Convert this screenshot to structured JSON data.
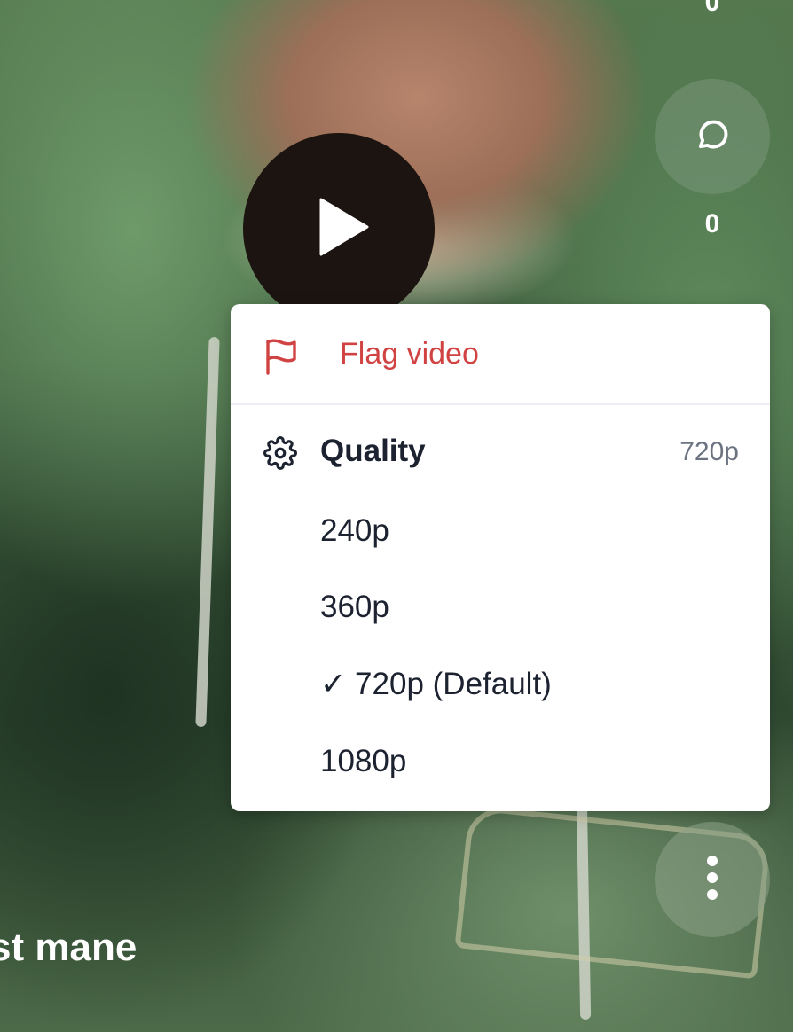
{
  "video": {
    "caption": "st mane"
  },
  "rail": {
    "top_count": "0",
    "comment_count": "0",
    "comment_icon": "comment-bubble-icon",
    "more_icon": "more-vertical-icon"
  },
  "player": {
    "play_icon": "play-icon"
  },
  "menu": {
    "flag": {
      "label": "Flag video",
      "icon": "flag-icon",
      "color": "#d14343"
    },
    "quality": {
      "label": "Quality",
      "icon": "gear-icon",
      "current_value": "720p",
      "options": [
        {
          "label": "240p"
        },
        {
          "label": "360p"
        },
        {
          "label": "✓ 720p (Default)"
        },
        {
          "label": "1080p"
        }
      ]
    }
  }
}
